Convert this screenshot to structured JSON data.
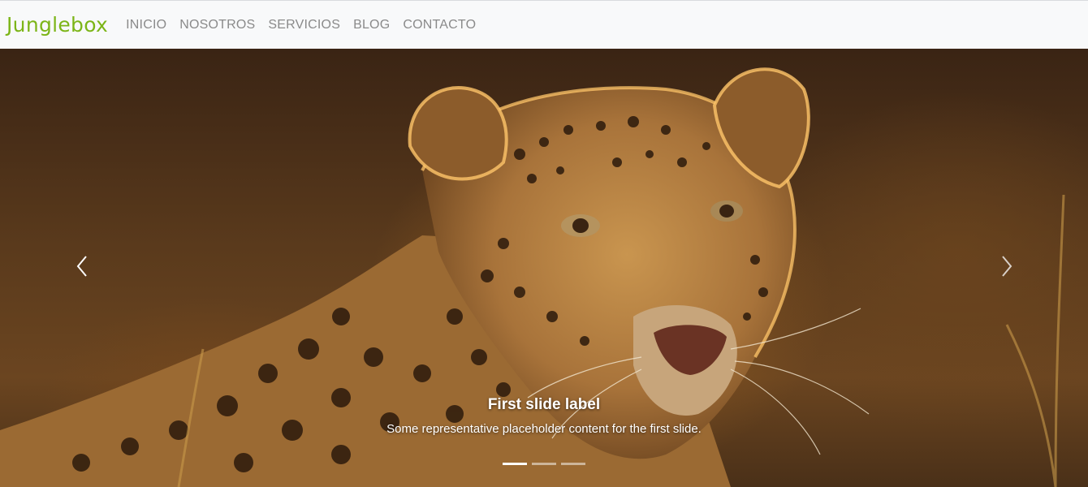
{
  "brand": {
    "name": "Junglebox",
    "color": "#7cb518"
  },
  "nav": {
    "items": [
      {
        "label": "INICIO"
      },
      {
        "label": "NOSOTROS"
      },
      {
        "label": "SERVICIOS"
      },
      {
        "label": "BLOG"
      },
      {
        "label": "CONTACTO"
      }
    ]
  },
  "carousel": {
    "caption_title": "First slide label",
    "caption_text": "Some representative placeholder content for the first slide.",
    "prev_icon": "chevron-left-icon",
    "next_icon": "chevron-right-icon",
    "slide_count": 3,
    "active_slide": 1
  }
}
